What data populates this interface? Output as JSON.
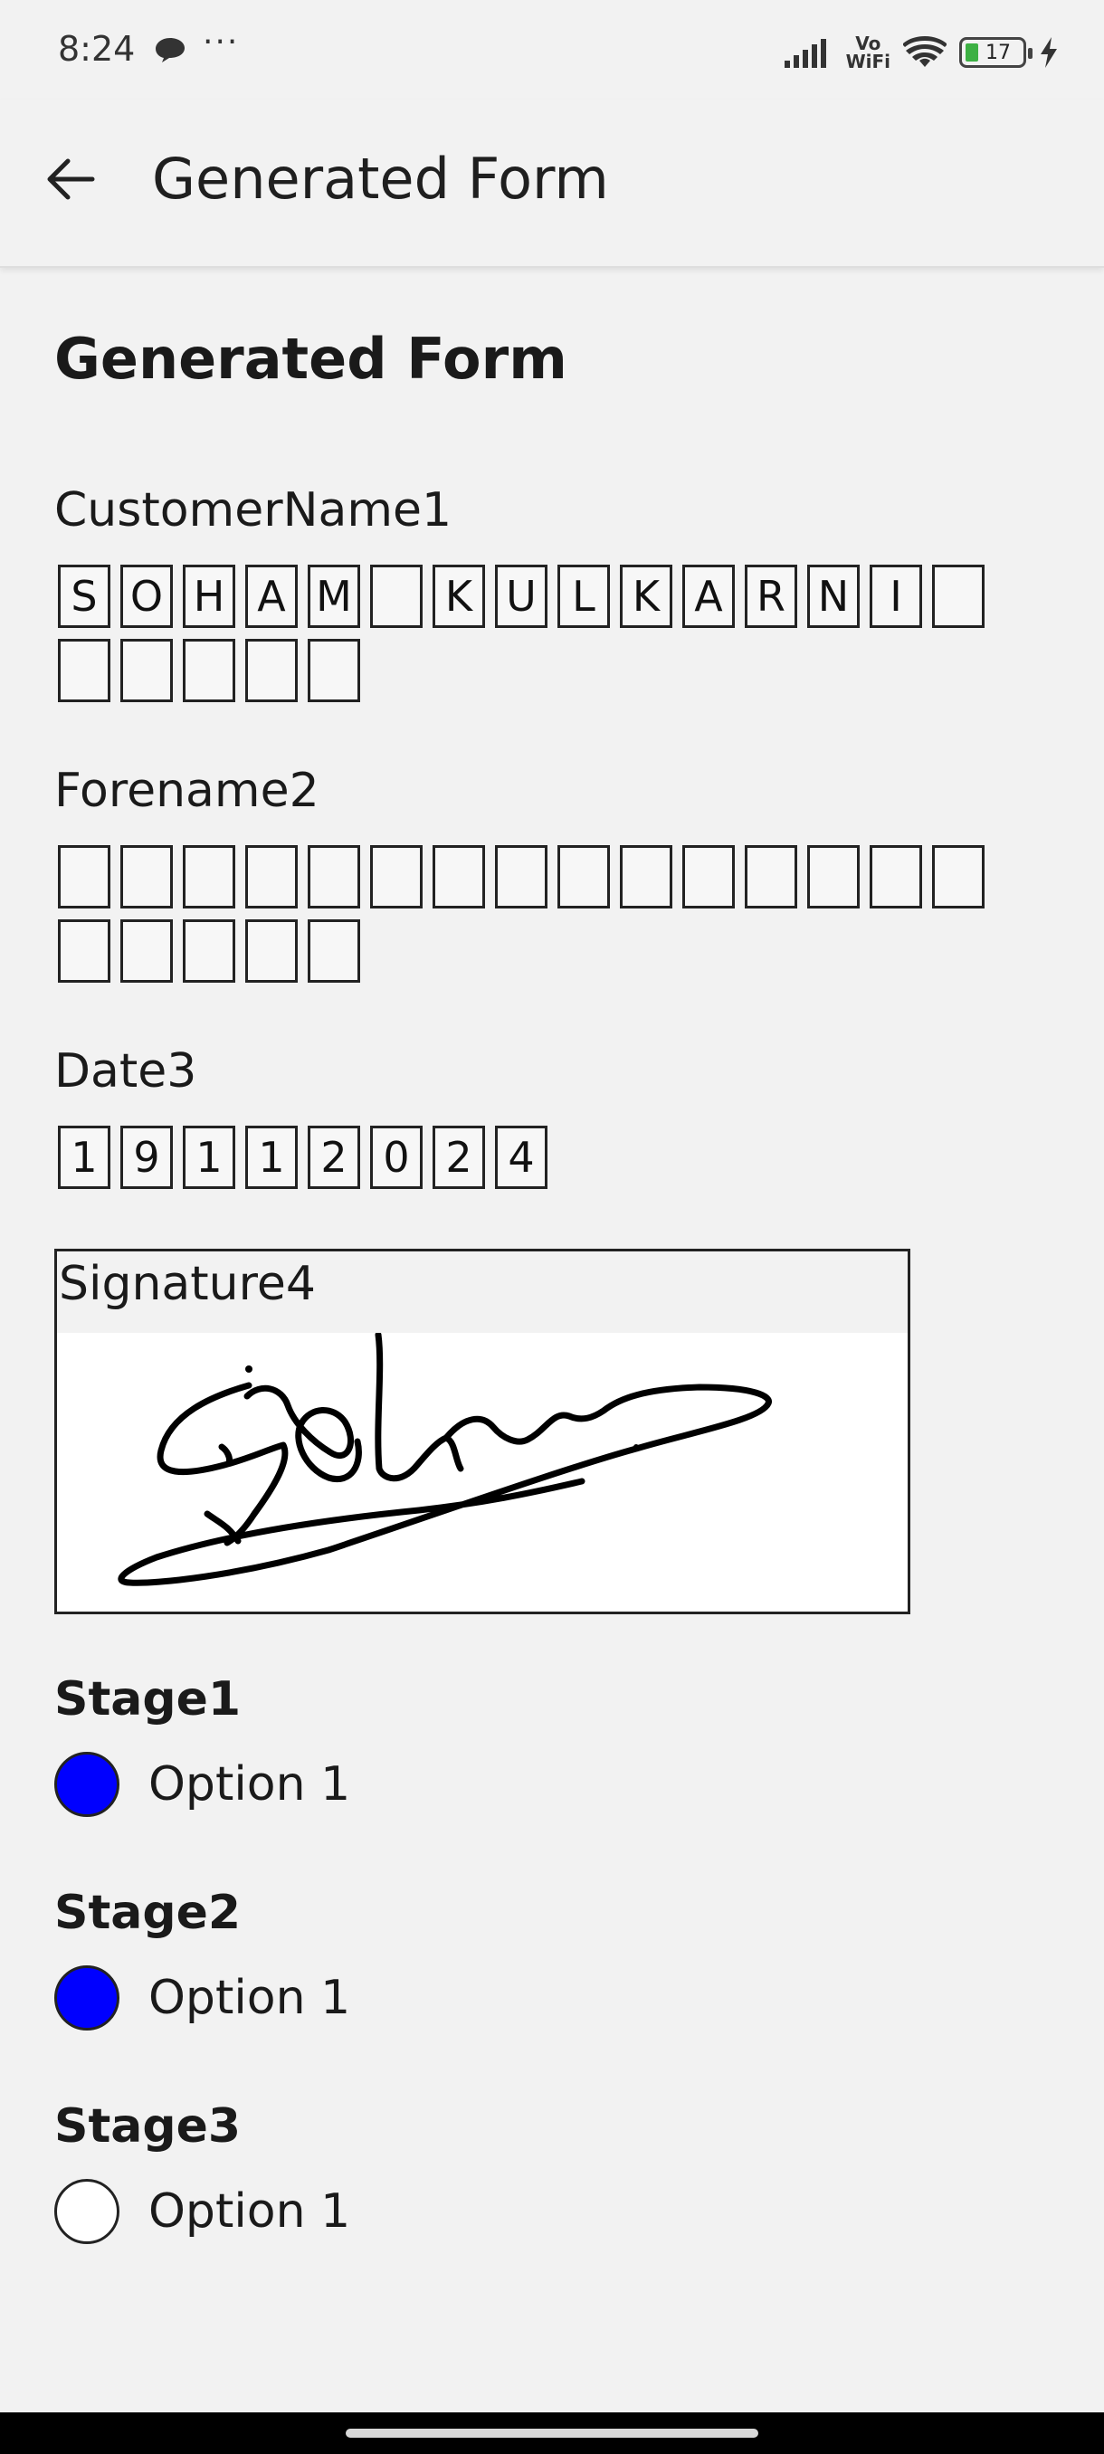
{
  "status_bar": {
    "time": "8:24",
    "more": "···",
    "volte_line1": "Vo",
    "volte_line2": "WiFi",
    "battery": "17",
    "icons": [
      "chat-bubble-icon",
      "signal-icon",
      "wifi-icon",
      "battery-icon",
      "charging-icon"
    ]
  },
  "app_bar": {
    "title": "Generated Form",
    "back_icon": "arrow-left-icon"
  },
  "form": {
    "title": "Generated Form",
    "customer_name": {
      "label": "CustomerName1",
      "chars": [
        "S",
        "O",
        "H",
        "A",
        "M",
        "",
        "K",
        "U",
        "L",
        "K",
        "A",
        "R",
        "N",
        "I",
        "",
        "",
        "",
        "",
        "",
        ""
      ]
    },
    "forename": {
      "label": "Forename2",
      "chars": [
        "",
        "",
        "",
        "",
        "",
        "",
        "",
        "",
        "",
        "",
        "",
        "",
        "",
        "",
        "",
        "",
        "",
        "",
        "",
        ""
      ]
    },
    "date": {
      "label": "Date3",
      "chars": [
        "1",
        "9",
        "1",
        "1",
        "2",
        "0",
        "2",
        "4"
      ]
    },
    "signature": {
      "label": "Signature4"
    },
    "stages": [
      {
        "title": "Stage1",
        "option": "Option 1",
        "selected": true
      },
      {
        "title": "Stage2",
        "option": "Option 1",
        "selected": true
      },
      {
        "title": "Stage3",
        "option": "Option 1",
        "selected": false
      }
    ]
  },
  "colors": {
    "background": "#f2f2f2",
    "radio_selected": "#0000ff",
    "border": "#222222"
  }
}
